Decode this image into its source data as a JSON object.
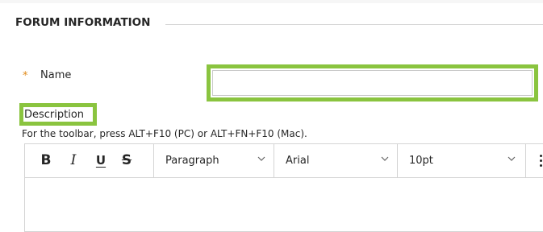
{
  "section": {
    "title": "FORUM INFORMATION"
  },
  "name_field": {
    "required_mark": "*",
    "label": "Name",
    "value": "",
    "placeholder": ""
  },
  "description": {
    "label": "Description",
    "toolbar_hint": "For the toolbar, press ALT+F10 (PC) or ALT+FN+F10 (Mac)."
  },
  "toolbar": {
    "bold": "B",
    "italic": "I",
    "underline": "U",
    "strikethrough": "S",
    "paragraph_format": "Paragraph",
    "font_family": "Arial",
    "font_size": "10pt"
  },
  "colors": {
    "highlight": "#8ac43f",
    "required": "#e08a17"
  }
}
